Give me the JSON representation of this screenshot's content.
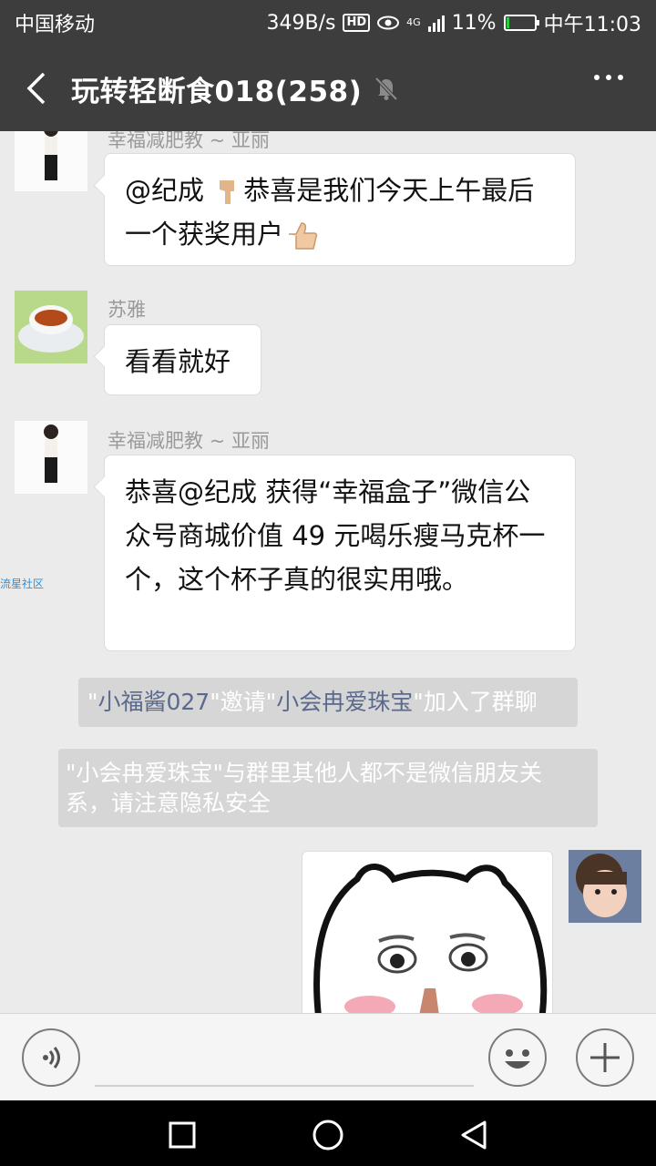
{
  "status_bar": {
    "carrier": "中国移动",
    "speed": "349B/s",
    "hd": "HD",
    "network": "4G",
    "battery": "11%",
    "time": "中午11:03"
  },
  "header": {
    "title": "玩转轻断食018(258)",
    "back_icon": "chevron-left-icon",
    "mute_icon": "bell-off-icon",
    "more_icon": "ellipsis-icon"
  },
  "messages": [
    {
      "sender": "幸福减肥教 ~ 亚丽",
      "text_a": "@纪成 ",
      "text_b": "恭喜是我们今天上午最后一个获奖用户"
    },
    {
      "sender": "苏雅",
      "text": "看看就好"
    },
    {
      "sender": "幸福减肥教 ~ 亚丽",
      "text": "恭喜@纪成 获得“幸福盒子”微信公众号商城价值 49 元喝乐瘦马克杯一个，这个杯子真的很实用哦。"
    }
  ],
  "system_messages": {
    "invite": {
      "q1": "\"",
      "inviter": "小福酱027",
      "mid": "\"邀请\"",
      "invitee": "小会冉爱珠宝",
      "tail": "\"加入了群聊"
    },
    "privacy": "\"小会冉爱珠宝\"与群里其他人都不是微信朋友关系，请注意隐私安全"
  },
  "side_label": "流星社区",
  "input_bar": {
    "placeholder": ""
  },
  "colors": {
    "titlebar": "#3d3d3d",
    "chat_bg": "#ebebeb",
    "link_blue": "#5a6a8e"
  }
}
